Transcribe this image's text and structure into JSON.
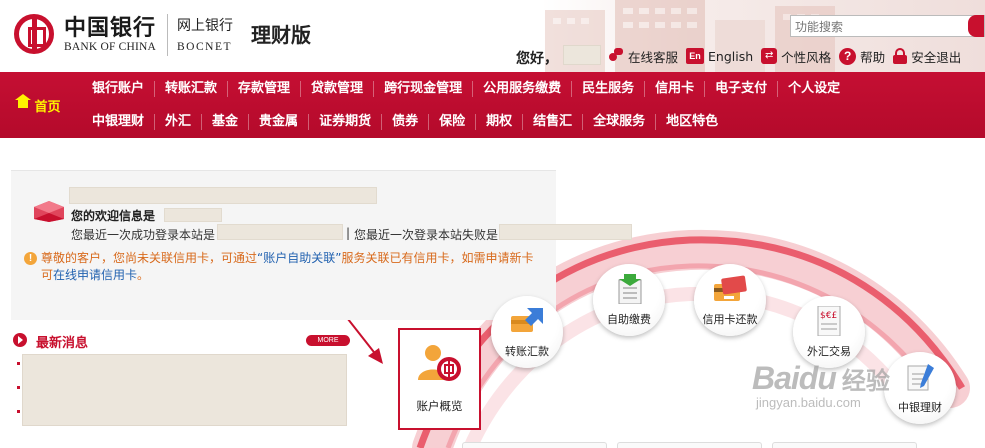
{
  "brand": {
    "name_cn": "中国银行",
    "name_en": "BANK OF CHINA",
    "channel_cn": "网上银行",
    "channel_en": "BOCNET",
    "edition": "理财版"
  },
  "search": {
    "placeholder": "功能搜索"
  },
  "user_bar": {
    "greeting": "您好，",
    "links": [
      {
        "icon": "customer-service-icon",
        "label": "在线客服"
      },
      {
        "icon": "english-icon",
        "icon_text": "En",
        "label": "English"
      },
      {
        "icon": "style-icon",
        "label": "个性风格"
      },
      {
        "icon": "help-icon",
        "icon_text": "?",
        "label": "帮助"
      },
      {
        "icon": "lock-icon",
        "label": "安全退出"
      }
    ]
  },
  "nav": {
    "home": "首页",
    "row1": [
      "银行账户",
      "转账汇款",
      "存款管理",
      "贷款管理",
      "跨行现金管理",
      "公用服务缴费",
      "民生服务",
      "信用卡",
      "电子支付",
      "个人设定"
    ],
    "row2": [
      "中银理财",
      "外汇",
      "基金",
      "贵金属",
      "证券期货",
      "债券",
      "保险",
      "期权",
      "结售汇",
      "全球服务",
      "地区特色"
    ]
  },
  "welcome": {
    "label": "您的欢迎信息是",
    "last_success": "您最近一次成功登录本站是",
    "separator": "|",
    "last_fail": "您最近一次登录本站失败是",
    "notice_icon": "!",
    "notice_a": "尊敬的客户，您尚未关联信用卡，可通过",
    "notice_link1": "“账户自助关联”",
    "notice_b": "服务关联已有信用卡，如需申请新卡可",
    "notice_link2": "在线申请信用卡",
    "notice_end": "。"
  },
  "news": {
    "title": "最新消息",
    "more": "MORE"
  },
  "shortcuts": [
    {
      "icon": "transfer-icon",
      "label": "转账汇款"
    },
    {
      "icon": "bill-payment-icon",
      "label": "自助缴费"
    },
    {
      "icon": "credit-card-repay-icon",
      "label": "信用卡还款"
    },
    {
      "icon": "forex-icon",
      "label": "外汇交易"
    },
    {
      "icon": "wealth-management-icon",
      "label": "中银理财"
    }
  ],
  "highlight": {
    "icon": "account-overview-icon",
    "label": "账户概览"
  },
  "watermark": {
    "main": "Baidu",
    "cn": "经验",
    "url": "jingyan.baidu.com"
  },
  "colors": {
    "brand_red": "#c8102e",
    "nav_highlight": "#fff200",
    "notice_orange": "#d86a1c",
    "link_blue": "#2262b0"
  }
}
